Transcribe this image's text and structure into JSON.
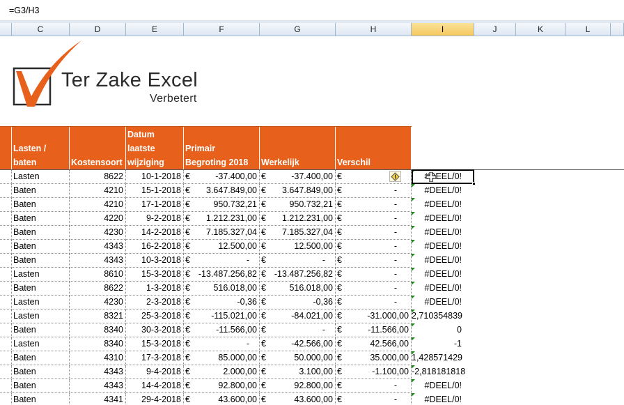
{
  "formula_bar": {
    "value": "=G3/H3"
  },
  "columns": [
    "C",
    "D",
    "E",
    "F",
    "G",
    "H",
    "I",
    "J",
    "K",
    "L"
  ],
  "selected_column": "I",
  "logo": {
    "title": "Ter Zake Excel",
    "subtitle": "Verbetert",
    "accent_color": "#e8611c"
  },
  "table_header": {
    "lasten_baten": "Lasten /\nbaten",
    "kostensoort": "Kostensoort",
    "datum": "Datum\nlaatste\nwijziging",
    "primair": "Primair\nBegroting 2018",
    "werkelijk": "Werkelijk",
    "verschil": "Verschil",
    "color": "#e8611c"
  },
  "rows": [
    {
      "type": "Lasten",
      "kost": "8622",
      "date": "10-1-2018",
      "prim": "-37.400,00",
      "werk": "-37.400,00",
      "versch": "",
      "result": "#DEEL/0!"
    },
    {
      "type": "Baten",
      "kost": "4210",
      "date": "15-1-2018",
      "prim": "3.647.849,00",
      "werk": "3.647.849,00",
      "versch": "-",
      "result": "#DEEL/0!"
    },
    {
      "type": "Baten",
      "kost": "4210",
      "date": "17-1-2018",
      "prim": "950.732,21",
      "werk": "950.732,21",
      "versch": "-",
      "result": "#DEEL/0!"
    },
    {
      "type": "Baten",
      "kost": "4220",
      "date": "9-2-2018",
      "prim": "1.212.231,00",
      "werk": "1.212.231,00",
      "versch": "-",
      "result": "#DEEL/0!"
    },
    {
      "type": "Baten",
      "kost": "4230",
      "date": "14-2-2018",
      "prim": "7.185.327,04",
      "werk": "7.185.327,04",
      "versch": "-",
      "result": "#DEEL/0!"
    },
    {
      "type": "Baten",
      "kost": "4343",
      "date": "16-2-2018",
      "prim": "12.500,00",
      "werk": "12.500,00",
      "versch": "-",
      "result": "#DEEL/0!"
    },
    {
      "type": "Baten",
      "kost": "4343",
      "date": "10-3-2018",
      "prim": "-",
      "werk": "-",
      "versch": "-",
      "result": "#DEEL/0!"
    },
    {
      "type": "Lasten",
      "kost": "8610",
      "date": "15-3-2018",
      "prim": "-13.487.256,82",
      "werk": "-13.487.256,82",
      "versch": "-",
      "result": "#DEEL/0!"
    },
    {
      "type": "Baten",
      "kost": "8622",
      "date": "1-3-2018",
      "prim": "516.018,00",
      "werk": "516.018,00",
      "versch": "-",
      "result": "#DEEL/0!"
    },
    {
      "type": "Lasten",
      "kost": "4230",
      "date": "2-3-2018",
      "prim": "-0,36",
      "werk": "-0,36",
      "versch": "-",
      "result": "#DEEL/0!"
    },
    {
      "type": "Lasten",
      "kost": "8321",
      "date": "25-3-2018",
      "prim": "-115.021,00",
      "werk": "-84.021,00",
      "versch": "-31.000,00",
      "result": "2,710354839"
    },
    {
      "type": "Baten",
      "kost": "8340",
      "date": "30-3-2018",
      "prim": "-11.566,00",
      "werk": "-",
      "versch": "-11.566,00",
      "result": "0"
    },
    {
      "type": "Lasten",
      "kost": "8340",
      "date": "15-3-2018",
      "prim": "-",
      "werk": "-42.566,00",
      "versch": "42.566,00",
      "result": "-1"
    },
    {
      "type": "Baten",
      "kost": "4310",
      "date": "17-3-2018",
      "prim": "85.000,00",
      "werk": "50.000,00",
      "versch": "35.000,00",
      "result": "1,428571429"
    },
    {
      "type": "Baten",
      "kost": "4343",
      "date": "9-4-2018",
      "prim": "2.000,00",
      "werk": "3.100,00",
      "versch": "-1.100,00",
      "result": "-2,818181818"
    },
    {
      "type": "Baten",
      "kost": "4343",
      "date": "14-4-2018",
      "prim": "92.800,00",
      "werk": "92.800,00",
      "versch": "-",
      "result": "#DEEL/0!"
    },
    {
      "type": "Baten",
      "kost": "4341",
      "date": "29-4-2018",
      "prim": "43.600,00",
      "werk": "43.600,00",
      "versch": "-",
      "result": "#DEEL/0!"
    }
  ],
  "currency_symbol": "€"
}
